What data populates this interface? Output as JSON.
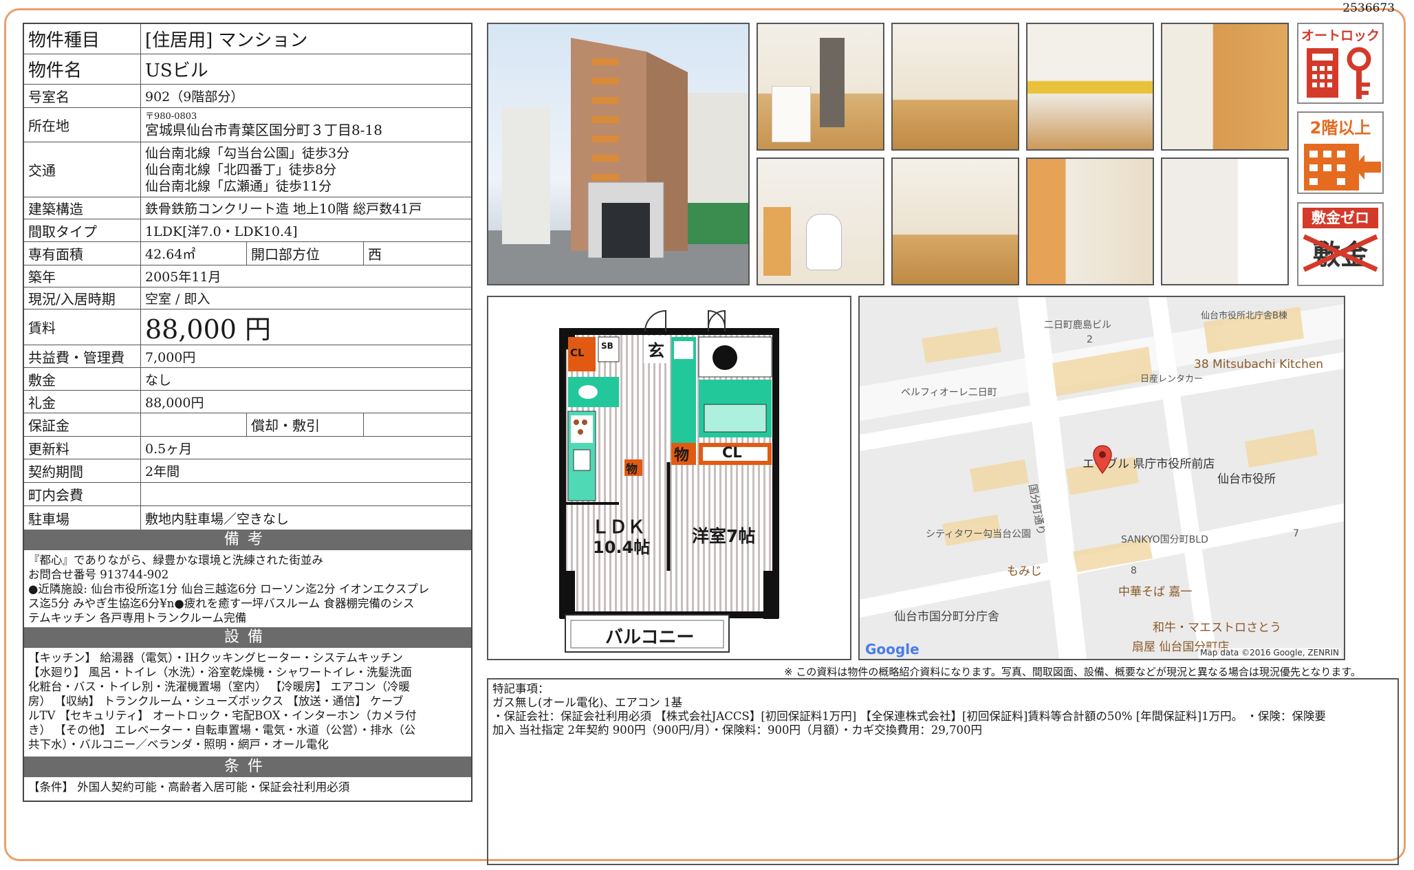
{
  "doc_id": "2536673",
  "property": {
    "type_label": "物件種目",
    "type_value": "[住居用] マンション",
    "name_label": "物件名",
    "name_value": "USビル",
    "room_label": "号室名",
    "room_value": "902（9階部分）",
    "address_label": "所在地",
    "address_zip": "〒980-0803",
    "address_value": "宮城県仙台市青葉区国分町３丁目8-18",
    "transport_label": "交通",
    "transport": [
      "仙台南北線「勾当台公園」徒歩3分",
      "仙台南北線「北四番丁」徒歩8分",
      "仙台南北線「広瀬通」徒歩11分"
    ],
    "structure_label": "建築構造",
    "structure_value": "鉄骨鉄筋コンクリート造 地上10階 総戸数41戸",
    "layout_label": "間取タイプ",
    "layout_value": "1LDK[洋7.0・LDK10.4]",
    "area_label": "専有面積",
    "area_value": "42.64㎡",
    "direction_label": "開口部方位",
    "direction_value": "西",
    "built_label": "築年",
    "built_value": "2005年11月",
    "status_label": "現況/入居時期",
    "status_value": "空室 / 即入",
    "rent_label": "賃料",
    "rent_value": "88,000 円",
    "fee_label": "共益費・管理費",
    "fee_value": "7,000円",
    "deposit_label": "敷金",
    "deposit_value": "なし",
    "keymoney_label": "礼金",
    "keymoney_value": "88,000円",
    "guarantee_label": "保証金",
    "guarantee_value": "",
    "amort_label": "償却・敷引",
    "amort_value": "",
    "renewal_label": "更新料",
    "renewal_value": "0.5ヶ月",
    "contract_label": "契約期間",
    "contract_value": "2年間",
    "town_label": "町内会費",
    "town_value": "",
    "parking_label": "駐車場",
    "parking_value": "敷地内駐車場／空きなし"
  },
  "remarks": {
    "header": "備考",
    "lines": [
      "『都心』でありながら、緑豊かな環境と洗練された街並み",
      "お問合せ番号 913744-902",
      "●近隣施設: 仙台市役所迄1分 仙台三越迄6分 ローソン迄2分 イオンエクスプレ",
      "ス迄5分 みやぎ生協迄6分¥n●疲れを癒す一坪バスルーム 食器棚完備のシス",
      "テムキッチン 各戸専用トランクルーム完備"
    ]
  },
  "facilities": {
    "header": "設備",
    "lines": [
      "【キッチン】 給湯器（電気）・IHクッキングヒーター・システムキッチン",
      "【水廻り】 風呂・トイレ（水洗）・浴室乾燥機・シャワートイレ・洗髪洗面",
      "化粧台・バス・トイレ別・洗濯機置場（室内） 【冷暖房】 エアコン（冷暖",
      "房） 【収納】 トランクルーム・シューズボックス 【放送・通信】 ケーブ",
      "ルTV 【セキュリティ】 オートロック・宅配BOX・インターホン（カメラ付",
      "き） 【その他】 エレベーター・自転車置場・電気・水道（公営）・排水（公",
      "共下水）・バルコニー／ベランダ・照明・網戸・オール電化"
    ]
  },
  "conditions": {
    "header": "条件",
    "text": "【条件】 外国人契約可能・高齢者入居可能・保証会社利用必須"
  },
  "badges": {
    "autolock": "オートロック",
    "floor": "2階以上",
    "deposit_zero": "敷金ゼロ",
    "deposit_word": "敷金"
  },
  "floorplan": {
    "entrance": "玄",
    "cl1": "CL",
    "sb": "SB",
    "storage1": "物",
    "storage2": "物",
    "cl2": "CL",
    "ldk": "ＬＤＫ",
    "ldk_size": "10.4帖",
    "western": "洋室7帖",
    "balcony": "バルコニー"
  },
  "map": {
    "labels": [
      "二日町鹿島ビル",
      "仙台市役所北庁舎B棟",
      "38 Mitsubachi Kitchen",
      "日産レンタカー",
      "ベルフィオーレ二日町",
      "エイブル 県庁市役所前店",
      "仙台市役所",
      "国分町通り",
      "シティタワー勾当台公園",
      "SANKYO国分町BLD",
      "もみじ",
      "中華そば 嘉一",
      "仙台市国分町分庁舎",
      "和牛・マエストロさとう",
      "扇屋 仙台国分町店"
    ],
    "numbers": [
      "2",
      "7",
      "8"
    ],
    "logo": "Google",
    "attribution": "Map data ©2016 Google, ZENRIN"
  },
  "note": "※ この資料は物件の概略紹介資料になります。写真、間取図面、設備、概要などが現況と異なる場合は現況優先となります。",
  "special": {
    "title": "特記事項：",
    "line1": "ガス無し(オール電化)、エアコン 1基",
    "line2": "・保証会社：保証会社利用必須 【株式会社JACCS】[初回保証料1万円] 【全保連株式会社】[初回保証料]賃料等合計額の50% [年間保証料]1万円。 ・保険：保険要",
    "line3": "加入 当社指定 2年契約 900円（900円/月）・保険料：900円（月額）・カギ交換費用：29,700円"
  }
}
